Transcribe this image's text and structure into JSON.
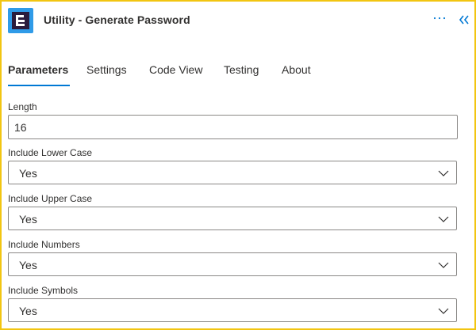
{
  "header": {
    "title": "Utility - Generate Password",
    "more_icon": "ellipsis-icon",
    "collapse_icon": "double-chevron-left-icon"
  },
  "tabs": [
    {
      "label": "Parameters",
      "active": true
    },
    {
      "label": "Settings"
    },
    {
      "label": "Code View"
    },
    {
      "label": "Testing"
    },
    {
      "label": "About"
    }
  ],
  "fields": {
    "length": {
      "label": "Length",
      "value": "16"
    },
    "lower": {
      "label": "Include Lower Case",
      "value": "Yes"
    },
    "upper": {
      "label": "Include Upper Case",
      "value": "Yes"
    },
    "numbers": {
      "label": "Include Numbers",
      "value": "Yes"
    },
    "symbols": {
      "label": "Include Symbols",
      "value": "Yes"
    }
  },
  "colors": {
    "frame_border": "#f2c511",
    "accent": "#0078d4",
    "logo_bg": "#2f9be8",
    "logo_inner": "#2a1b3d"
  }
}
